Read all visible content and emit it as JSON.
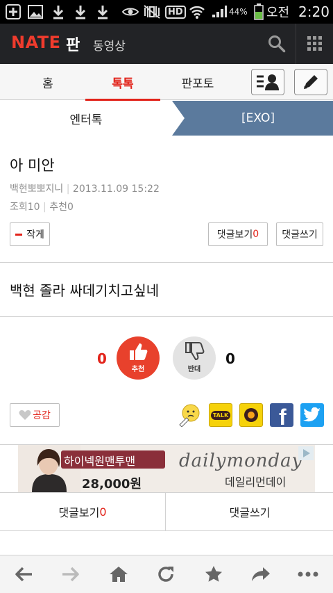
{
  "status_bar": {
    "battery": "44%",
    "ampm": "오전",
    "time": "2:20",
    "hd": "HD"
  },
  "header": {
    "logo": "NATE",
    "logo_suffix": "판",
    "subtitle": "동영상"
  },
  "tabs": [
    {
      "label": "홈",
      "active": false
    },
    {
      "label": "톡톡",
      "active": true
    },
    {
      "label": "판포토",
      "active": false
    }
  ],
  "breadcrumb": {
    "category": "엔터톡",
    "board": "[EXO]"
  },
  "post": {
    "title": "아 미안",
    "author": "백현뽀뽀지니",
    "date": "2013.11.09 15:22",
    "views_label": "조회",
    "views": "10",
    "recommend_label": "추천",
    "recommend": "0",
    "body": "백현 졸라 싸데기치고싶네"
  },
  "actions": {
    "font_small": "작게",
    "comments_view": "댓글보기",
    "comments_count": "0",
    "comments_write": "댓글쓰기"
  },
  "vote": {
    "up_count": "0",
    "up_label": "추천",
    "down_count": "0",
    "down_label": "반대"
  },
  "share": {
    "empathy": "공감",
    "kakao": "TALK",
    "facebook": "f"
  },
  "ad": {
    "line1": "하이넥원맨투맨",
    "price": "28,000원",
    "brand": "dailymonday",
    "brand_kr": "데일리먼데이"
  },
  "bottom_tabs": {
    "view": "댓글보기",
    "view_count": "0",
    "write": "댓글쓰기"
  },
  "colors": {
    "brand_red": "#e2231a",
    "header_bg": "#222326",
    "board_blue": "#5b7a9d",
    "facebook": "#3b5998",
    "twitter": "#1da1f2",
    "kakao": "#f6d20a"
  }
}
